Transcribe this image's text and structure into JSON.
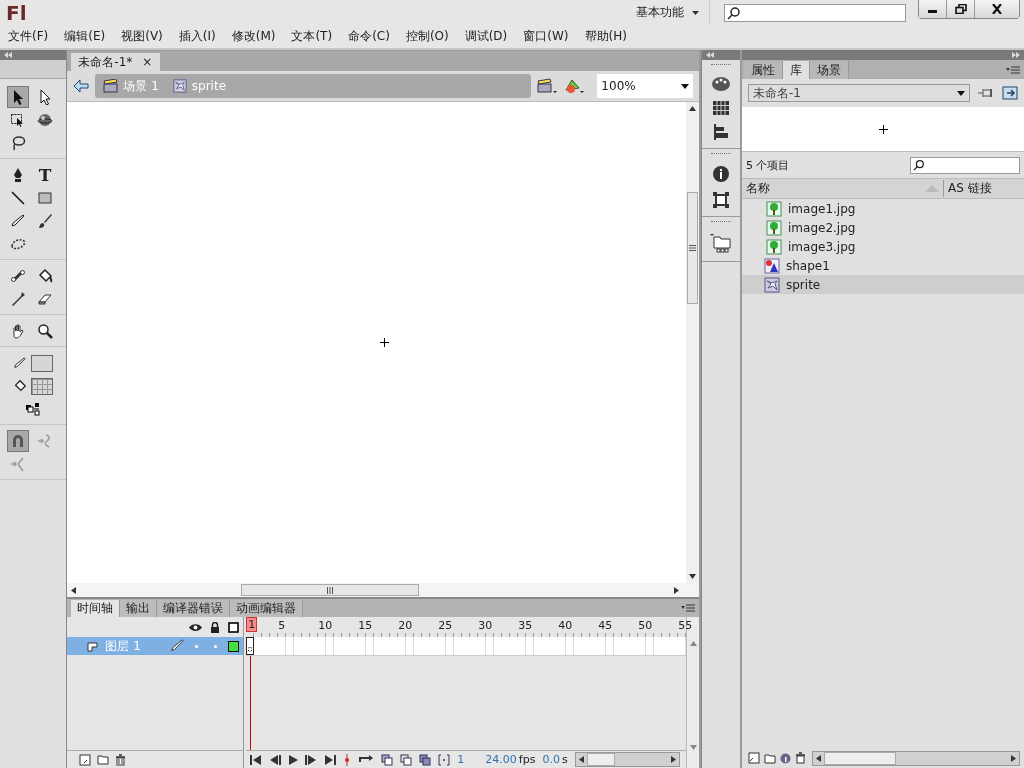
{
  "app": {
    "logo": "Fl",
    "workspace": "基本功能"
  },
  "menu": [
    "文件(F)",
    "编辑(E)",
    "视图(V)",
    "插入(I)",
    "修改(M)",
    "文本(T)",
    "命令(C)",
    "控制(O)",
    "调试(D)",
    "窗口(W)",
    "帮助(H)"
  ],
  "tool_groups": [
    [
      {
        "kind": "selection",
        "selected": true
      },
      {
        "kind": "subselection",
        "selected": false
      },
      {
        "kind": "free-transform",
        "selected": false
      },
      {
        "kind": "rotate",
        "selected": false
      },
      {
        "kind": "lasso",
        "selected": false
      }
    ],
    [
      {
        "kind": "pen",
        "selected": false
      },
      {
        "kind": "text",
        "glyph": "T",
        "selected": false
      },
      {
        "kind": "line",
        "selected": false
      },
      {
        "kind": "rectangle",
        "selected": false
      },
      {
        "kind": "pencil",
        "selected": false
      },
      {
        "kind": "brush",
        "selected": false
      },
      {
        "kind": "deco",
        "selected": false
      }
    ],
    [
      {
        "kind": "bone",
        "selected": false
      },
      {
        "kind": "paint-bucket",
        "selected": false
      },
      {
        "kind": "eyedropper",
        "selected": false
      },
      {
        "kind": "eraser",
        "selected": false
      }
    ],
    [
      {
        "kind": "hand",
        "selected": false
      },
      {
        "kind": "zoom",
        "selected": false
      }
    ],
    [
      {
        "kind": "stroke-color",
        "selected": false
      },
      {
        "kind": "fill-color",
        "selected": false
      },
      {
        "kind": "swap-colors",
        "selected": false
      }
    ],
    [
      {
        "kind": "snap",
        "selected": true
      },
      {
        "kind": "smooth",
        "selected": false
      },
      {
        "kind": "straighten",
        "selected": false
      }
    ]
  ],
  "document_tab": {
    "title": "未命名-1*",
    "close": "×"
  },
  "edit_bar": {
    "breadcrumbs": [
      {
        "kind": "scene",
        "label": "场景 1"
      },
      {
        "kind": "symbol",
        "label": "sprite"
      }
    ],
    "zoom": "100%"
  },
  "timeline": {
    "tabs": [
      {
        "label": "时间轴",
        "selected": true
      },
      {
        "label": "输出",
        "selected": false
      },
      {
        "label": "编译器错误",
        "selected": false
      },
      {
        "label": "动画编辑器",
        "selected": false
      }
    ],
    "ruler": [
      "1",
      "5",
      "10",
      "15",
      "20",
      "25",
      "30",
      "35",
      "40",
      "45",
      "50",
      "55"
    ],
    "layers": [
      {
        "name": "图层 1",
        "selected": true,
        "color": "#44dd44"
      }
    ],
    "current_frame": "1",
    "frame_rate": "24.00",
    "fps_unit": "fps",
    "elapsed": "0.0",
    "time_unit": "s"
  },
  "panel": {
    "tabs": [
      {
        "label": "属性",
        "selected": false
      },
      {
        "label": "库",
        "selected": true
      },
      {
        "label": "场景",
        "selected": false
      }
    ],
    "library": "未命名-1",
    "count": "5 个项目",
    "columns": [
      "名称",
      "AS 链接"
    ],
    "items": [
      {
        "name": "image1.jpg",
        "kind": "bitmap",
        "selected": false
      },
      {
        "name": "image2.jpg",
        "kind": "bitmap",
        "selected": false
      },
      {
        "name": "image3.jpg",
        "kind": "bitmap",
        "selected": false
      },
      {
        "name": "shape1",
        "kind": "graphic",
        "selected": false
      },
      {
        "name": "sprite",
        "kind": "movieclip",
        "selected": true
      }
    ]
  }
}
